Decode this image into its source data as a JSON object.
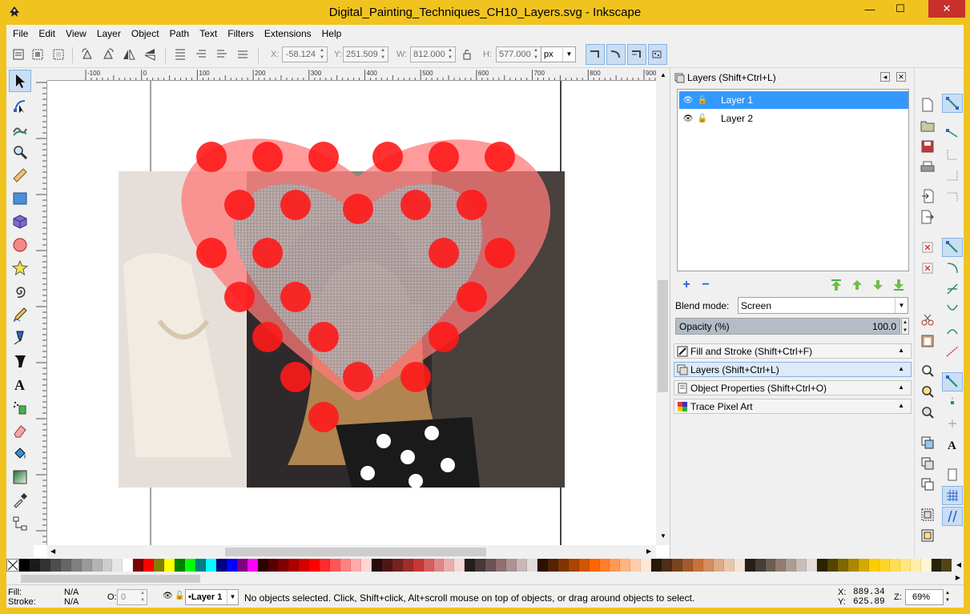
{
  "window": {
    "title": "Digital_Painting_Techniques_CH10_Layers.svg - Inkscape",
    "min_glyph": "—",
    "max_glyph": "☐",
    "close_glyph": "✕"
  },
  "menu": [
    "File",
    "Edit",
    "View",
    "Layer",
    "Object",
    "Path",
    "Text",
    "Filters",
    "Extensions",
    "Help"
  ],
  "toolbar": {
    "x_label": "X:",
    "x_value": "-58.124",
    "y_label": "Y:",
    "y_value": "251.509",
    "w_label": "W:",
    "w_value": "812.000",
    "h_label": "H:",
    "h_value": "577.000",
    "unit": "px"
  },
  "ruler": {
    "ticks": [
      "-100",
      "0",
      "100",
      "200",
      "300",
      "400",
      "500",
      "600",
      "700",
      "800",
      "900"
    ]
  },
  "panel": {
    "title": "Layers (Shift+Ctrl+L)",
    "layers": [
      {
        "name": "Layer 1",
        "selected": true
      },
      {
        "name": "Layer 2",
        "selected": false
      }
    ],
    "add_glyph": "+",
    "remove_glyph": "−",
    "blend_label": "Blend mode:",
    "blend_value": "Screen",
    "opacity_label": "Opacity (%)",
    "opacity_value": "100.0",
    "opacity_fraction": 1.0,
    "docked": [
      {
        "label": "Fill and Stroke (Shift+Ctrl+F)",
        "active": false
      },
      {
        "label": "Layers (Shift+Ctrl+L)",
        "active": true
      },
      {
        "label": "Object Properties (Shift+Ctrl+O)",
        "active": false
      },
      {
        "label": "Trace Pixel Art",
        "active": false
      }
    ]
  },
  "status": {
    "fill_label": "Fill:",
    "fill_value": "N/A",
    "stroke_label": "Stroke:",
    "stroke_value": "N/A",
    "o_label": "O:",
    "o_value": "0",
    "layer_value": "•Layer 1",
    "message": "No objects selected. Click, Shift+click, Alt+scroll mouse on top of objects, or drag around objects to select.",
    "x_label": "X:",
    "x_value": "889.34",
    "y_label": "Y:",
    "y_value": "625.89",
    "z_label": "Z:",
    "zoom": "69%"
  },
  "colors": {
    "title_bar": "#f0c31f",
    "close_button": "#c7302b",
    "selection": "#3399ff",
    "heart_fill": "#ff7a7a",
    "dot": "#ff1a1a"
  },
  "palette": [
    "#000000",
    "#1a1a1a",
    "#333333",
    "#4d4d4d",
    "#666666",
    "#808080",
    "#999999",
    "#b3b3b3",
    "#cccccc",
    "#e6e6e6",
    "#ffffff",
    "#800000",
    "#ff0000",
    "#808000",
    "#ffff00",
    "#008000",
    "#00ff00",
    "#008080",
    "#00ffff",
    "#000080",
    "#0000ff",
    "#800080",
    "#ff00ff",
    "#2b0000",
    "#550000",
    "#800000",
    "#aa0000",
    "#d40000",
    "#ff0000",
    "#ff2a2a",
    "#ff5555",
    "#ff8080",
    "#ffaaaa",
    "#ffd5d5",
    "#280b0b",
    "#501616",
    "#782121",
    "#a02c2c",
    "#c83737",
    "#d35f5f",
    "#de8787",
    "#e9afaf",
    "#f4d7d7",
    "#241c1c",
    "#483737",
    "#6c5353",
    "#916f6f",
    "#ac9393",
    "#c8b7b7",
    "#e3dbdb",
    "#2b1100",
    "#552200",
    "#803300",
    "#aa4400",
    "#d45500",
    "#ff6600",
    "#ff7f2a",
    "#ff9955",
    "#ffb380",
    "#ffccaa",
    "#ffe6d5",
    "#28170b",
    "#502d16",
    "#784421",
    "#a05a2c",
    "#c87137",
    "#d38d5f",
    "#deaa87",
    "#e9c6af",
    "#f4e3d7",
    "#241f1c",
    "#483e37",
    "#6c5d53",
    "#917c6f",
    "#ac9d93",
    "#c8beb7",
    "#e3dedb",
    "#2b2200",
    "#554400",
    "#806600",
    "#aa8800",
    "#d4aa00",
    "#ffcc00",
    "#ffd42a",
    "#ffdd55",
    "#ffe680",
    "#ffeeaa",
    "#fff6d5",
    "#28220b",
    "#504416"
  ]
}
